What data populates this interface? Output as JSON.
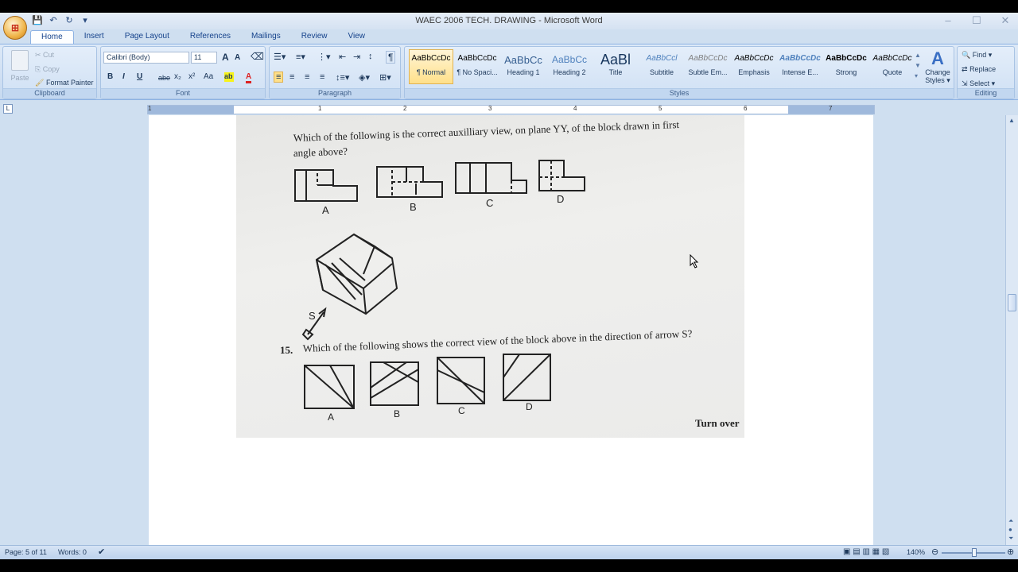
{
  "window": {
    "title": "WAEC 2006 TECH. DRAWING - Microsoft Word",
    "controls": {
      "minimize": "–",
      "maximize": "☐",
      "close": "✕"
    }
  },
  "qat": {
    "save": "💾",
    "undo": "↶",
    "redo": "↻",
    "more": "▾"
  },
  "tabs": [
    "Home",
    "Insert",
    "Page Layout",
    "References",
    "Mailings",
    "Review",
    "View"
  ],
  "clipboard": {
    "label": "Clipboard",
    "paste": "Paste",
    "cut": "Cut",
    "copy": "Copy",
    "format_painter": "Format Painter"
  },
  "font": {
    "label": "Font",
    "family": "Calibri (Body)",
    "size": "11",
    "grow": "A",
    "shrink": "A",
    "bold": "B",
    "italic": "I",
    "underline": "U",
    "strike": "abe",
    "subscript": "x₂",
    "superscript": "x²",
    "change_case": "Aa",
    "color": "A"
  },
  "paragraph": {
    "label": "Paragraph",
    "pilcrow": "¶"
  },
  "styles": {
    "label": "Styles",
    "items": [
      {
        "sample": "AaBbCcDc",
        "name": "¶ Normal"
      },
      {
        "sample": "AaBbCcDc",
        "name": "¶ No Spaci..."
      },
      {
        "sample": "AaBbCc",
        "name": "Heading 1"
      },
      {
        "sample": "AaBbCc",
        "name": "Heading 2"
      },
      {
        "sample": "AaBl",
        "name": "Title"
      },
      {
        "sample": "AaBbCcl",
        "name": "Subtitle"
      },
      {
        "sample": "AaBbCcDc",
        "name": "Subtle Em..."
      },
      {
        "sample": "AaBbCcDc",
        "name": "Emphasis"
      },
      {
        "sample": "AaBbCcDc",
        "name": "Intense E..."
      },
      {
        "sample": "AaBbCcDc",
        "name": "Strong"
      },
      {
        "sample": "AaBbCcDc",
        "name": "Quote"
      }
    ],
    "change_styles_line1": "Change",
    "change_styles_line2": "Styles ▾"
  },
  "editing": {
    "label": "Editing",
    "find": "Find ▾",
    "replace": "Replace",
    "select": "Select ▾"
  },
  "ruler": {
    "numbers": [
      "1",
      "1",
      "2",
      "3",
      "4",
      "5",
      "6",
      "7"
    ],
    "tab_selector": "L"
  },
  "scan": {
    "q14_line1": "Which of the following is the correct auxilliary view, on plane YY, of the block drawn in first",
    "q14_line2": "angle above?",
    "q14_options": [
      "A",
      "B",
      "C",
      "D"
    ],
    "arrow_label": "S",
    "q15_number": "15.",
    "q15_text": "Which of the following shows the correct view of the block above in the direction of arrow S?",
    "q15_options": [
      "A",
      "B",
      "C",
      "D"
    ],
    "turn_over": "Turn over"
  },
  "status": {
    "page": "Page: 5 of 11",
    "words": "Words: 0",
    "zoom": "140%"
  }
}
